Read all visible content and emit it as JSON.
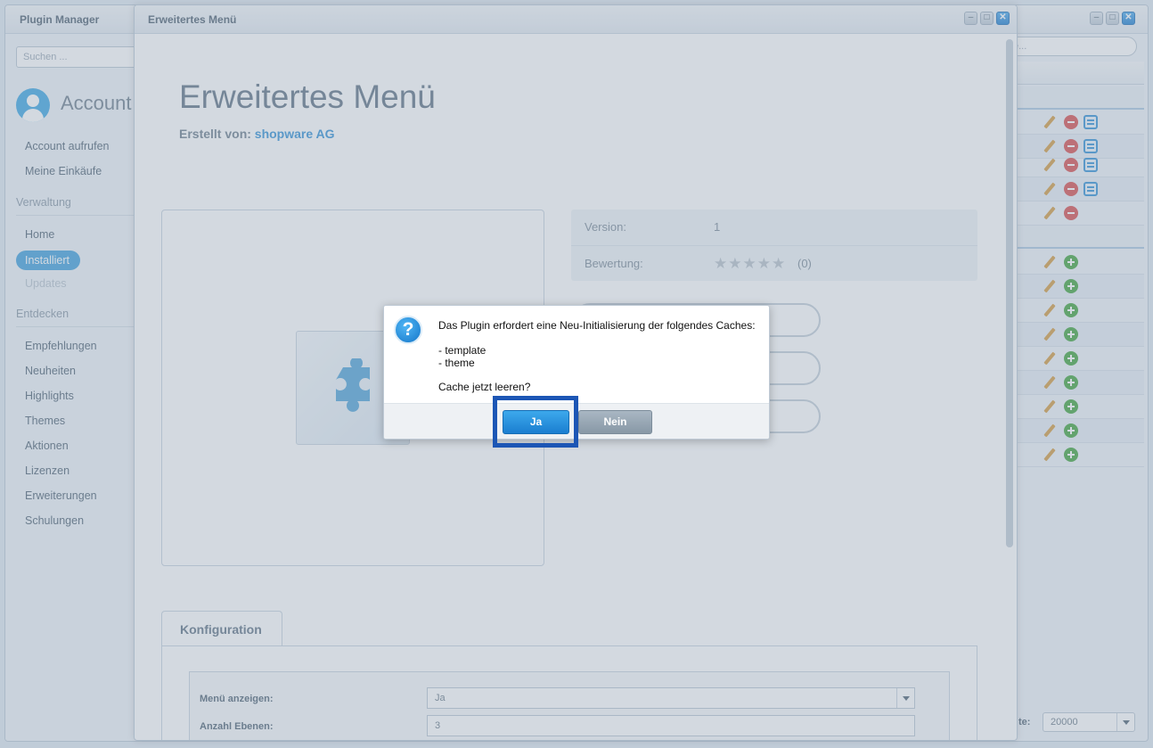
{
  "plugin_manager": {
    "title": "Plugin Manager",
    "search_placeholder": "Suchen ...",
    "account_title": "Account",
    "account_items": [
      "Account aufrufen",
      "Meine Einkäufe"
    ],
    "section_verwaltung": "Verwaltung",
    "verwaltung_items": [
      "Home",
      "Installiert",
      "Updates"
    ],
    "section_entdecken": "Entdecken",
    "entdecken_items": [
      "Empfehlungen",
      "Neuheiten",
      "Highlights",
      "Themes",
      "Aktionen",
      "Lizenzen",
      "Erweiterungen",
      "Schulungen"
    ],
    "right_search_text": "e...",
    "pager_label": "te:",
    "pager_value": "20000"
  },
  "detail": {
    "window_title": "Erweitertes Menü",
    "heading": "Erweitertes Menü",
    "author_label": "Erstellt von:",
    "author_name": "shopware AG",
    "version_label": "Version:",
    "version_value": "1",
    "rating_label": "Bewertung:",
    "rating_stars": "★★★★★",
    "rating_count": "(0)",
    "tab_label": "Konfiguration",
    "config": {
      "menu_label": "Menü anzeigen:",
      "menu_value": "Ja",
      "levels_label": "Anzahl Ebenen:",
      "levels_value": "3"
    }
  },
  "dialog": {
    "icon": "question-icon",
    "message": "Das Plugin erfordert eine Neu-Initialisierung der folgendes Caches:",
    "cache_items": [
      "- template",
      "- theme"
    ],
    "question": "Cache jetzt leeren?",
    "yes_label": "Ja",
    "no_label": "Nein"
  },
  "colors": {
    "accent": "#3d9fdc",
    "highlight": "#1c56b5"
  }
}
